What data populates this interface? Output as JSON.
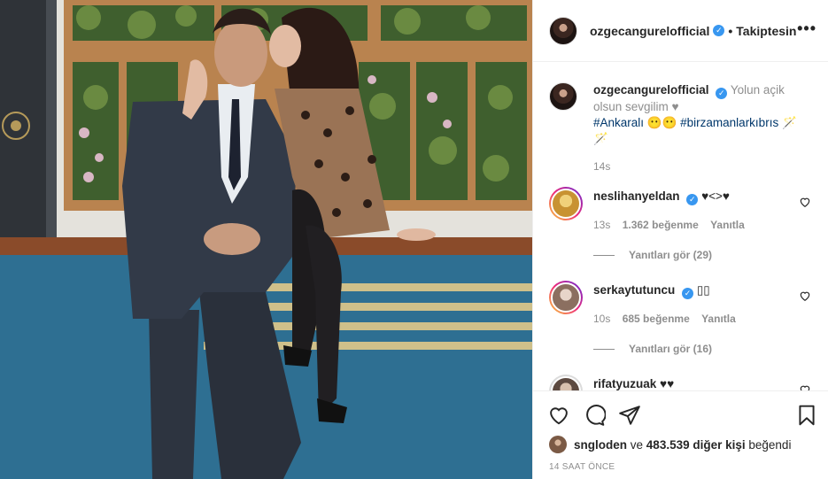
{
  "post": {
    "username": "ozgecangurelofficial",
    "verified_mark": "✓",
    "separator": "•",
    "follow_label": "Takiptesin",
    "more_icon": "more-dots-icon",
    "more_label": "•••"
  },
  "caption": {
    "username": "ozgecangurelofficial",
    "text": "Yolun açik olsun sevgilim ♥",
    "hashtags": "#Ankaralı 😶😶 #birzamanlarkıbrıs 🪄",
    "extra": "🪄",
    "time": "14s"
  },
  "comments": [
    {
      "username": "neslihanyeldan",
      "text": "♥<>♥",
      "time": "13s",
      "likes": "1.362 beğenme",
      "reply": "Yanıtla",
      "view_replies": "Yanıtları gör (29)"
    },
    {
      "username": "serkaytutuncu",
      "text": "▯▯",
      "time": "10s",
      "likes": "685 beğenme",
      "reply": "Yanıtla",
      "view_replies": "Yanıtları gör (16)"
    },
    {
      "username": "rifatyuzuak",
      "text": "♥♥"
    }
  ],
  "actions": {
    "like_icon": "heart-icon",
    "comment_icon": "comment-icon",
    "share_icon": "paper-plane-icon",
    "save_icon": "bookmark-icon"
  },
  "likes_summary": {
    "liker": "sngloden",
    "middle": "ve",
    "count": "483.539 diğer kişi",
    "suffix": "beğendi"
  },
  "posted_ago": "14 SAAT ÖNCE",
  "colors": {
    "verified": "#3897f0",
    "hashtag": "#00376b",
    "muted": "#8e8e8e",
    "border": "#efefef"
  }
}
